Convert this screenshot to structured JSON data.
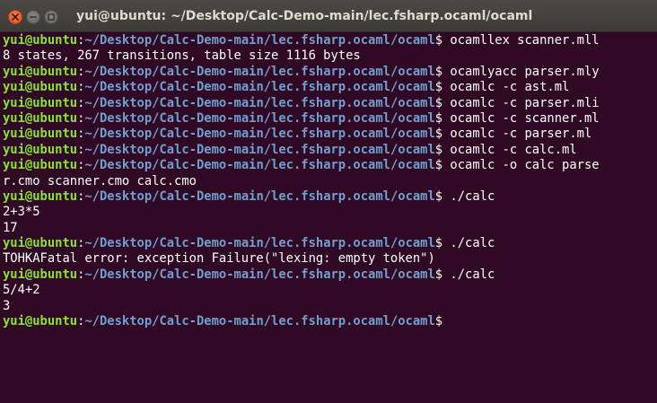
{
  "window": {
    "title": "yui@ubuntu: ~/Desktop/Calc-Demo-main/lec.fsharp.ocaml/ocaml"
  },
  "prompt": {
    "user": "yui@ubuntu",
    "colon": ":",
    "path": "~/Desktop/Calc-Demo-main/lec.fsharp.ocaml/ocaml",
    "dollar": "$ "
  },
  "lines": [
    {
      "type": "prompt",
      "cmd": "ocamllex scanner.mll"
    },
    {
      "type": "output",
      "text": "8 states, 267 transitions, table size 1116 bytes"
    },
    {
      "type": "prompt",
      "cmd": "ocamlyacc parser.mly"
    },
    {
      "type": "prompt",
      "cmd": "ocamlc -c ast.ml"
    },
    {
      "type": "prompt",
      "cmd": "ocamlc -c parser.mli"
    },
    {
      "type": "prompt",
      "cmd": "ocamlc -c scanner.ml"
    },
    {
      "type": "prompt",
      "cmd": "ocamlc -c parser.ml"
    },
    {
      "type": "prompt",
      "cmd": "ocamlc -c calc.ml"
    },
    {
      "type": "prompt",
      "cmd": "ocamlc -o calc parse"
    },
    {
      "type": "output",
      "text": "r.cmo scanner.cmo calc.cmo"
    },
    {
      "type": "prompt",
      "cmd": "./calc"
    },
    {
      "type": "output",
      "text": "2+3*5"
    },
    {
      "type": "output",
      "text": "17"
    },
    {
      "type": "prompt",
      "cmd": "./calc"
    },
    {
      "type": "output",
      "text": "TOHKAFatal error: exception Failure(\"lexing: empty token\")"
    },
    {
      "type": "prompt",
      "cmd": "./calc"
    },
    {
      "type": "output",
      "text": "5/4+2"
    },
    {
      "type": "output",
      "text": "3"
    },
    {
      "type": "prompt",
      "cmd": ""
    }
  ],
  "colors": {
    "background": "#300a24",
    "user": "#8ae234",
    "path": "#729fcf",
    "text": "#ffffff",
    "close_button": "#df4b16"
  }
}
